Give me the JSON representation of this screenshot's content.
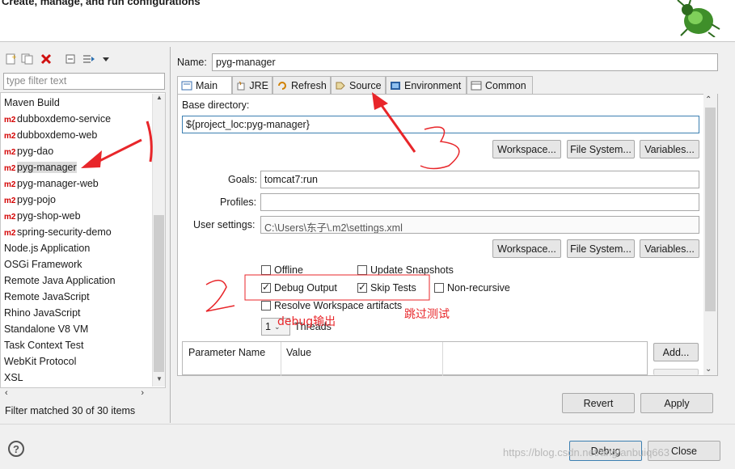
{
  "header": {
    "title": "Create, manage, and run configurations"
  },
  "left": {
    "filter_placeholder": "type filter text",
    "items": [
      {
        "label": "Maven Build",
        "m2": false
      },
      {
        "label": "dubboxdemo-service",
        "m2": true
      },
      {
        "label": "dubboxdemo-web",
        "m2": true
      },
      {
        "label": "pyg-dao",
        "m2": true
      },
      {
        "label": "pyg-manager",
        "m2": true,
        "selected": true
      },
      {
        "label": "pyg-manager-web",
        "m2": true
      },
      {
        "label": "pyg-pojo",
        "m2": true
      },
      {
        "label": "pyg-shop-web",
        "m2": true
      },
      {
        "label": "spring-security-demo",
        "m2": true
      },
      {
        "label": "Node.js Application",
        "m2": false
      },
      {
        "label": "OSGi Framework",
        "m2": false
      },
      {
        "label": "Remote Java Application",
        "m2": false
      },
      {
        "label": "Remote JavaScript",
        "m2": false
      },
      {
        "label": "Rhino JavaScript",
        "m2": false
      },
      {
        "label": "Standalone V8 VM",
        "m2": false
      },
      {
        "label": "Task Context Test",
        "m2": false
      },
      {
        "label": "WebKit Protocol",
        "m2": false
      },
      {
        "label": "XSL",
        "m2": false
      }
    ],
    "m2_badge": "m2",
    "status": "Filter matched 30 of 30 items"
  },
  "config": {
    "name_label": "Name:",
    "name_value": "pyg-manager",
    "tabs": [
      "Main",
      "JRE",
      "Refresh",
      "Source",
      "Environment",
      "Common"
    ],
    "base_dir_label": "Base directory:",
    "base_dir_value": "${project_loc:pyg-manager}",
    "workspace_btn": "Workspace...",
    "filesystem_btn": "File System...",
    "variables_btn": "Variables...",
    "goals_label": "Goals:",
    "goals_value": "tomcat7:run",
    "profiles_label": "Profiles:",
    "profiles_value": "",
    "user_settings_label": "User settings:",
    "user_settings_value": "C:\\Users\\东子\\.m2\\settings.xml",
    "offline": "Offline",
    "update_snapshots": "Update Snapshots",
    "debug_output": "Debug Output",
    "skip_tests": "Skip Tests",
    "non_recursive": "Non-recursive",
    "resolve_ws": "Resolve Workspace artifacts",
    "threads_value": "1",
    "threads_label": "Threads",
    "param_name_col": "Parameter Name",
    "value_col": "Value",
    "add_btn": "Add...",
    "revert_btn": "Revert",
    "apply_btn": "Apply"
  },
  "footer": {
    "debug_btn": "Debug",
    "close_btn": "Close",
    "watermark": "https://blog.csdn.net/ang/anbuiq663"
  },
  "annotations": {
    "debug_note": "debug输出",
    "skip_note": "跳过测试"
  },
  "colors": {
    "annotation": "#e8262a",
    "m2": "#d40000",
    "focus": "#3c7fb1"
  }
}
